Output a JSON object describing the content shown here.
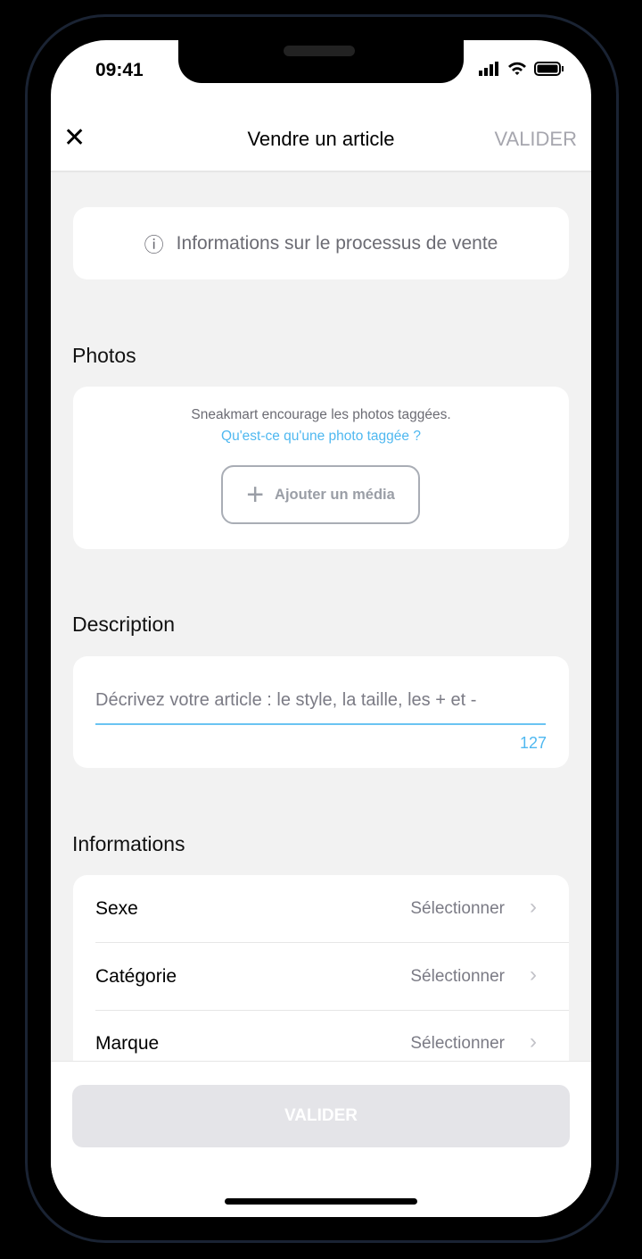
{
  "status": {
    "time": "09:41"
  },
  "header": {
    "close": "✕",
    "title": "Vendre un article",
    "validate": "VALIDER"
  },
  "info_banner": {
    "icon": "ⓘ",
    "text": "Informations sur le processus de vente"
  },
  "photos": {
    "heading": "Photos",
    "note": "Sneakmart encourage les photos taggées.",
    "link": "Qu'est-ce qu'une photo taggée ?",
    "add_icon": "+",
    "add_label": "Ajouter un média",
    "link_color": "#4fb8f0"
  },
  "description": {
    "heading": "Description",
    "placeholder": "Décrivez votre article : le style, la taille, les + et -",
    "counter": "127"
  },
  "informations": {
    "heading": "Informations",
    "rows": [
      {
        "label": "Sexe",
        "value": "Sélectionner"
      },
      {
        "label": "Catégorie",
        "value": "Sélectionner"
      },
      {
        "label": "Marque",
        "value": "Sélectionner"
      }
    ]
  },
  "footer": {
    "validate": "VALIDER"
  }
}
